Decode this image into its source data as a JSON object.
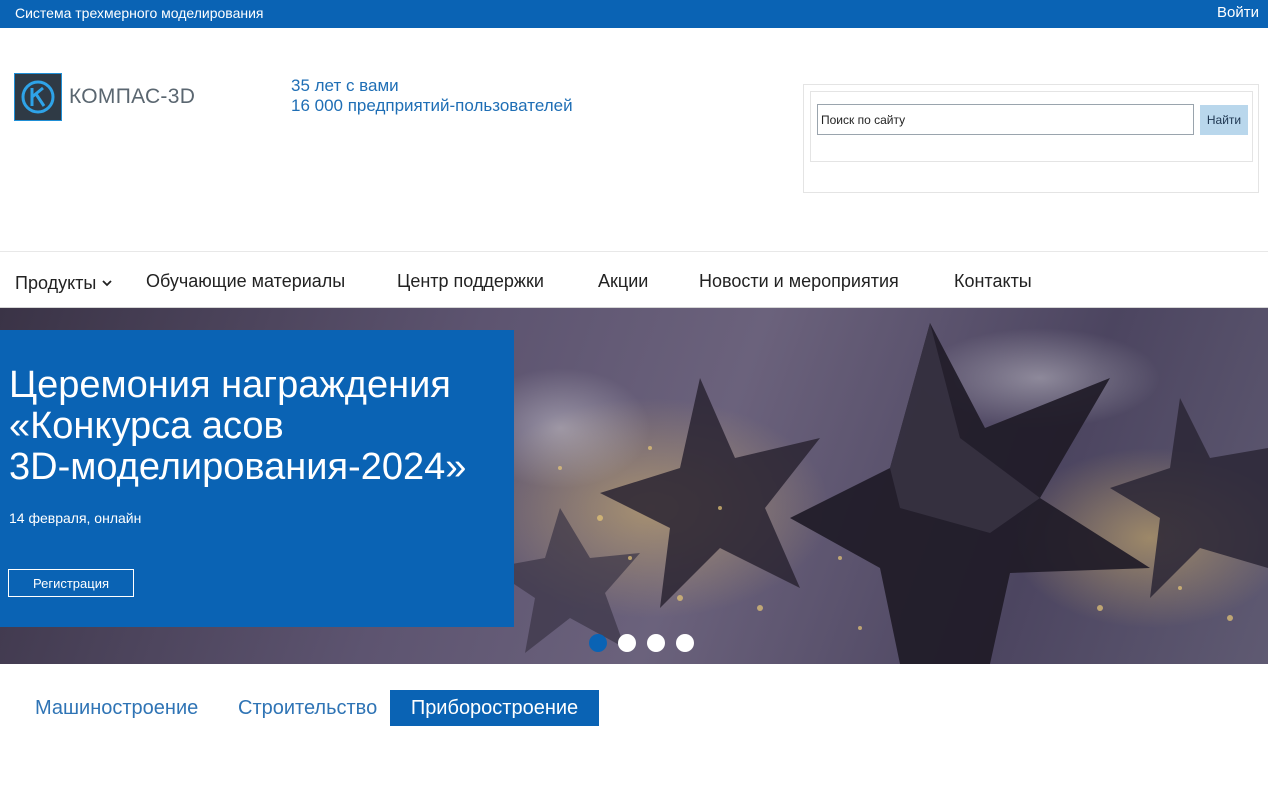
{
  "topbar": {
    "site_title": "Система трехмерного моделирования",
    "login": "Войти"
  },
  "logo": {
    "name": "КОМПАС-3D"
  },
  "tagline": {
    "line1": "35 лет с вами",
    "line2": "16 000 предприятий-пользователей"
  },
  "search": {
    "placeholder": "Поиск по сайту",
    "value": "",
    "button": "Найти"
  },
  "nav": {
    "items": [
      {
        "label": "Продукты",
        "has_dropdown": true
      },
      {
        "label": "Обучающие материалы"
      },
      {
        "label": "Центр поддержки"
      },
      {
        "label": "Акции"
      },
      {
        "label": "Новости и мероприятия"
      },
      {
        "label": "Контакты"
      }
    ]
  },
  "hero": {
    "title_lines": [
      "Церемония награждения",
      "«Конкурса асов",
      "3D-моделирования-2024»"
    ],
    "date": "14 февраля, онлайн",
    "button": "Регистрация",
    "slides_total": 4,
    "active_slide": 1
  },
  "tabs": {
    "items": [
      {
        "label": "Машиностроение",
        "active": false
      },
      {
        "label": "Строительство",
        "active": false
      },
      {
        "label": "Приборостроение",
        "active": true
      }
    ]
  },
  "colors": {
    "brand_blue": "#0a63b4",
    "tagline_blue": "#1e6eb5",
    "search_button_bg": "#b9d7ec",
    "tab_text": "#2f74b5"
  },
  "icons": {
    "logo_mark": "kompas-logo-icon",
    "nav_dropdown": "chevron-down-icon"
  }
}
